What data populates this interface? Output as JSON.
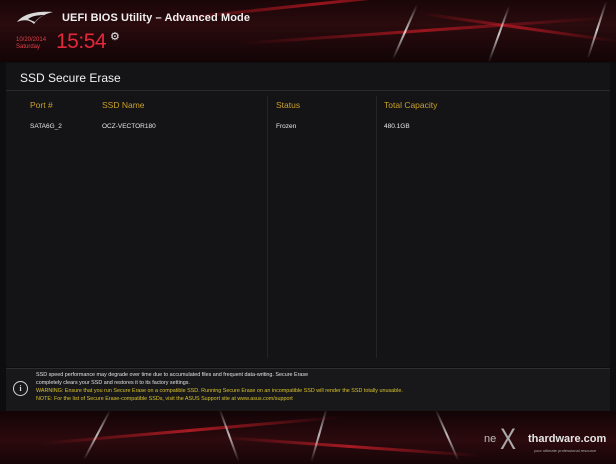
{
  "header": {
    "app_title": "UEFI BIOS Utility – Advanced Mode",
    "date": "10/20/2014",
    "day": "Saturday",
    "time": "15:54",
    "settings_icon": "gear-icon",
    "logo_icon": "rog-eye-logo"
  },
  "page": {
    "title": "SSD Secure Erase"
  },
  "table": {
    "columns": [
      "Port #",
      "SSD Name",
      "Status",
      "Total Capacity"
    ],
    "rows": [
      [
        "SATA6G_2",
        "OCZ-VECTOR180",
        "Frozen",
        "480.1GB"
      ]
    ]
  },
  "info": {
    "icon": "info-icon",
    "lines": [
      "SSD speed performance may degrade over time due to accumulated files and frequent data-writing. Secure Erase",
      "completely clears your SSD and restores it to its factory settings.",
      "WARNING: Ensure that you run Secure Erase on a compatible SSD. Running Secure Erase on an incompatible SSD will render the SSD totally unusable.",
      "NOTE: For the list of Secure Erase-compatible SSDs, visit the ASUS Support site at www.asus.com/support"
    ]
  },
  "watermark": {
    "prefix": "ne",
    "x": "X",
    "suffix": "thardware.com",
    "tagline": "your ultimate professional resource"
  },
  "colors": {
    "accent_red": "#e3283a",
    "column_header": "#c8a02a",
    "warning_yellow": "#d9c22a"
  }
}
